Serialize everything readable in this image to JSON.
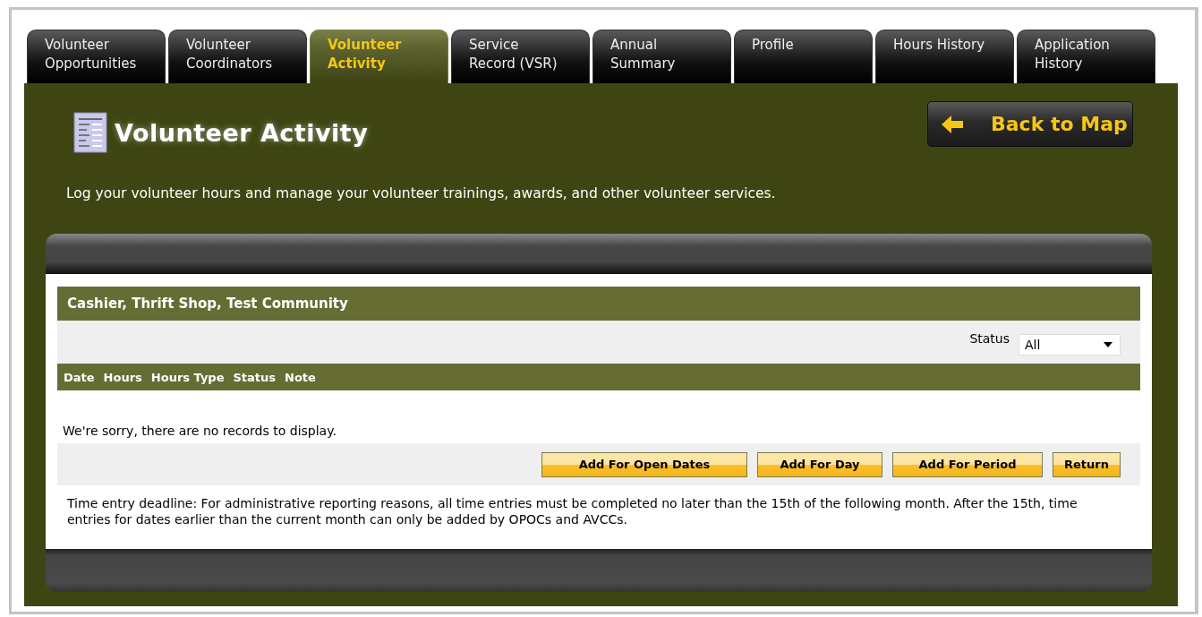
{
  "tabs": [
    {
      "label": "Volunteer\nOpportunities",
      "selected": false
    },
    {
      "label": "Volunteer\nCoordinators",
      "selected": false
    },
    {
      "label": "Volunteer\nActivity",
      "selected": true
    },
    {
      "label": "Service\nRecord (VSR)",
      "selected": false
    },
    {
      "label": "Annual\nSummary",
      "selected": false
    },
    {
      "label": "Profile",
      "selected": false
    },
    {
      "label": "Hours History",
      "selected": false
    },
    {
      "label": "Application\nHistory",
      "selected": false
    }
  ],
  "page": {
    "title": "Volunteer Activity",
    "back_button": "Back to Map",
    "description": "Log your volunteer hours and manage your volunteer trainings, awards, and other volunteer services."
  },
  "activity": {
    "heading": "Cashier, Thrift Shop, Test Community",
    "status_filter": {
      "label": "Status",
      "value": "All"
    },
    "columns": [
      "Date",
      "Hours",
      "Hours Type",
      "Status",
      "Note"
    ],
    "empty_message": "We're sorry, there are no records to display.",
    "buttons": [
      "Add For Open Dates",
      "Add For Day",
      "Add For Period",
      "Return"
    ],
    "note": "Time entry deadline: For administrative reporting reasons, all time entries must be completed no later than the 15th of the following month. After the 15th, time entries for dates earlier than the current month can only be added by OPOCs and AVCCs."
  }
}
